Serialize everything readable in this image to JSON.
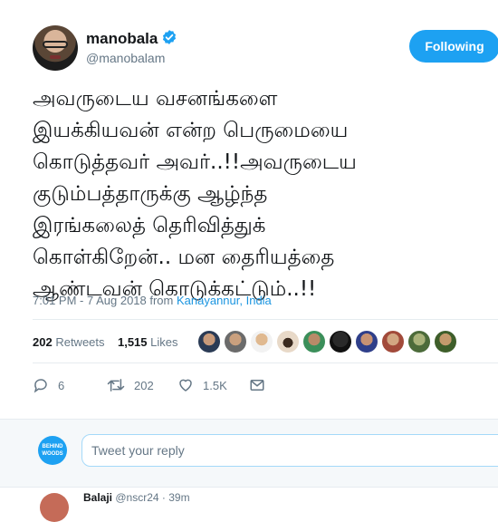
{
  "user": {
    "name": "manobala",
    "handle": "@manobalam",
    "follow_label": "Following"
  },
  "tweet": {
    "lines": [
      "அவருடைய வசனங்களை",
      "இயக்கியவன் என்ற பெருமையை",
      "கொடுத்தவர் அவர்..!!அவருடைய",
      "குடும்பத்தாருக்கு ஆழ்ந்த",
      "இரங்கலைத் தெரிவித்துக்",
      "கொள்கிறேன்.. மன தைரியத்தை",
      "ஆண்டவன் கொடுக்கட்டும்..!!"
    ],
    "time": "7:01 PM - 7 Aug 2018 from ",
    "place": "Kanayannur, India"
  },
  "stats": {
    "retweets_count": "202",
    "retweets_label": "Retweets",
    "likes_count": "1,515",
    "likes_label": "Likes"
  },
  "actions": {
    "replies": "6",
    "retweets": "202",
    "likes": "1.5K"
  },
  "reply_box": {
    "placeholder": "Tweet your reply",
    "logo_line1": "BEHIND",
    "logo_line2": "WOODS"
  },
  "next_reply": {
    "name": "Balaji",
    "handle_time": "@nscr24 · 39m"
  },
  "colors": {
    "accent": "#1da1f2",
    "link": "#1b95e0",
    "muted": "#657786"
  }
}
